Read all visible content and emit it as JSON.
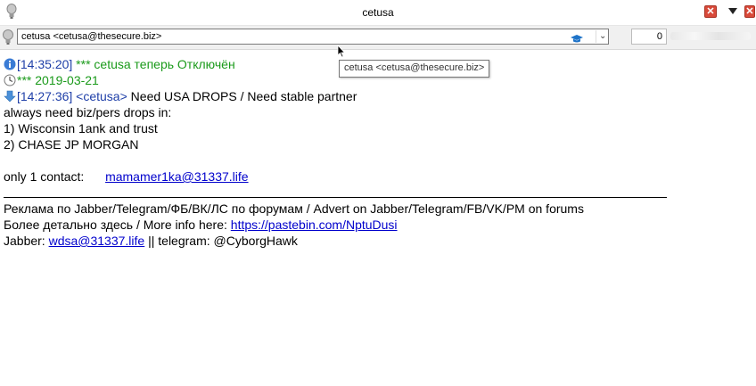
{
  "window": {
    "title": "cetusa",
    "colors": {
      "close": "#d94a3a",
      "status_green": "#1a9a1a",
      "timestamp_blue": "#1f3fa8",
      "link": "#0000cc"
    }
  },
  "contact_bar": {
    "contact": "cetusa <cetusa@thesecure.biz>",
    "count": "0"
  },
  "tooltip": "cetusa <cetusa@thesecure.biz>",
  "messages": {
    "status_time": "[14:35:20]",
    "status_text": "*** cetusa теперь Отключён",
    "date_text": "*** 2019-03-21",
    "msg_time": "[14:27:36]",
    "msg_nick": "<cetusa>",
    "msg_first": "Need USA DROPS / Need stable partner",
    "l1": "always need biz/pers drops in:",
    "l2": "1) Wisconsin 1ank and trust",
    "l3": "2) CHASE JP MORGAN",
    "contact_label": "only 1 contact:",
    "contact_link": "mamamer1ka@31337.life",
    "ad_line": "Реклама по Jabber/Telegram/ФБ/ВК/ЛС по форумам / Advert on Jabber/Telegram/FB/VK/PM on forums",
    "more_label": "Более детально здесь / More info here:",
    "more_link": "https://pastebin.com/NptuDusi",
    "jabber_label": "Jabber:",
    "jabber_link": "wdsa@31337.life",
    "telegram": "|| telegram: @CyborgHawk"
  }
}
